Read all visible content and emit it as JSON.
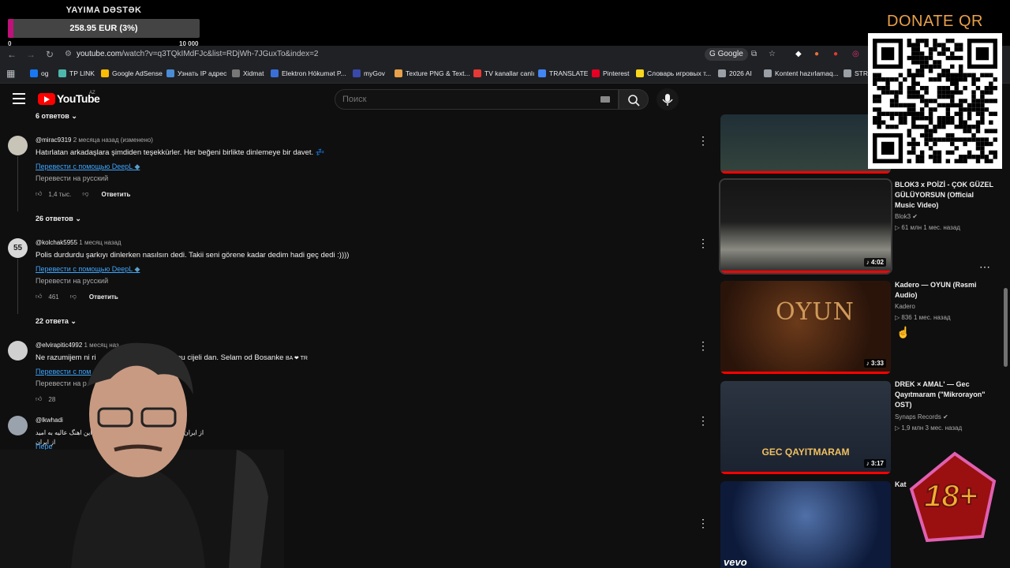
{
  "overlay": {
    "donate_title": "YAYIMA DƏSTƏK",
    "donate_amount": "258.95 EUR (3%)",
    "donate_min": "0",
    "donate_max": "10 000",
    "donate_progress_percent": 3,
    "qr_label": "DONATE QR",
    "age_badge": "18+"
  },
  "browser": {
    "url_host": "youtube.com",
    "url_path": "/watch?v=q3TQkIMdFJc&list=RDjWh-7JGuxTo&index=2",
    "google_chip": "Google",
    "bookmarks": [
      {
        "label": "og",
        "color": "#1877f2"
      },
      {
        "label": "TP LINK",
        "color": "#4db6ac"
      },
      {
        "label": "Google AdSense",
        "color": "#fbbc04"
      },
      {
        "label": "Узнать IP адрес",
        "color": "#4a8cd6"
      },
      {
        "label": "Xidmat",
        "color": "#777777"
      },
      {
        "label": "Elektron Hökumət P...",
        "color": "#3a6fd8"
      },
      {
        "label": "myGov",
        "color": "#3949ab"
      },
      {
        "label": "Texture PNG & Text...",
        "color": "#e8a04a"
      },
      {
        "label": "TV kanallar canlı",
        "color": "#e53935"
      },
      {
        "label": "TRANSLATE",
        "color": "#4285f4"
      },
      {
        "label": "Pinterest",
        "color": "#e60023"
      },
      {
        "label": "Словарь игровых т...",
        "color": "#f9d71c"
      },
      {
        "label": "2026 AI",
        "color": "#9aa0a6"
      },
      {
        "label": "Kontent hazırlamaq...",
        "color": "#9aa0a6"
      },
      {
        "label": "STRE",
        "color": "#9aa0a6"
      }
    ]
  },
  "youtube": {
    "wordmark": "YouTube",
    "country": "AZ",
    "search_placeholder": "Поиск"
  },
  "comments": {
    "top_replies": "6 ответов",
    "items": [
      {
        "author": "@mirac9319",
        "time": "2 месяца назад (изменено)",
        "text": "Hatırlatan arkadaşlara şimdiden teşekkürler. Her beğeni birlikte dinlemeye bir davet. 💤",
        "deepl": "Перевести с помощью DeepL",
        "translate": "Перевести на русский",
        "likes": "1,4 тыс.",
        "reply": "Ответить",
        "replies": "26 ответов"
      },
      {
        "author": "@kolchak5955",
        "time": "1 месяц назад",
        "text": "Polis durdurdu şarkıyı dinlerken nasılsın dedi. Takii seni görene kadar dedim hadi geç dedi :))))",
        "deepl": "Перевести с помощью DeepL",
        "translate": "Перевести на русский",
        "likes": "461",
        "reply": "Ответить",
        "replies": "22 ответа"
      },
      {
        "author": "@elvirapitic4992",
        "time": "1 месяц наз",
        "text": "Ne razumijem ni ri",
        "text_tail": "mu cijeli dan. Selam od Bosanke",
        "text_flags": "BA ❤ TR",
        "deepl": "Перевести с пом",
        "translate": "Перевести на р",
        "likes": "28"
      },
      {
        "author": "@lkwhadi",
        "text": "از ایران درود به مردم خوب ومهربون ترکیه این اهنگ عالیه به امید",
        "text_line2": "از ایران",
        "deepl": "Пере",
        "translate": "Пе"
      }
    ]
  },
  "sidebar": {
    "videos": [
      {
        "title": "",
        "channel": "",
        "stats": "",
        "duration": ""
      },
      {
        "title": "BLOK3 x POİZİ - ÇOK GÜZEL GÜLÜYORSUN (Official Music Video)",
        "channel": "Blok3",
        "stats": "▷ 61 млн  1 мес. назад",
        "duration": "4:02"
      },
      {
        "title": "Kadero — OYUN (Rəsmi Audio)",
        "channel": "Kadero",
        "stats": "▷ 836  1 мес. назад",
        "duration": "3:33",
        "thumb_text": "OYUN"
      },
      {
        "title": "DREK × AMAL' — Gec Qayıtmaram (\"Mikrorayon\" OST)",
        "channel": "Synaps Records",
        "stats": "▷ 1,9 млн  3 мес. назад",
        "duration": "3:17",
        "thumb_text": "GEC QAYITMARAM"
      },
      {
        "title": "Kat",
        "channel": "",
        "stats": "",
        "duration": "",
        "thumb_text": "vevo"
      }
    ]
  }
}
